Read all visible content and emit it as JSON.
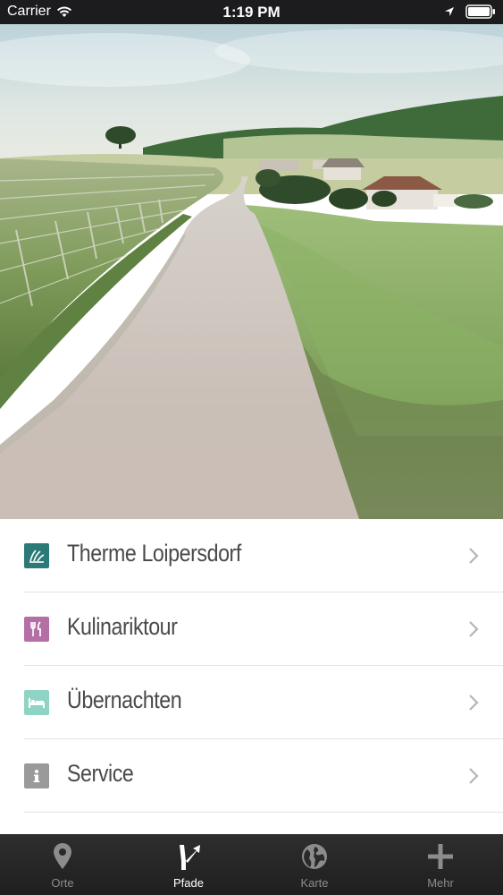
{
  "status_bar": {
    "carrier": "Carrier",
    "time": "1:19 PM"
  },
  "menu": {
    "items": [
      {
        "label": "Therme Loipersdorf",
        "icon": "spa-leaf-icon",
        "icon_color": "#2c7a78"
      },
      {
        "label": "Kulinariktour",
        "icon": "fork-knife-icon",
        "icon_color": "#b46fa6"
      },
      {
        "label": "Übernachten",
        "icon": "bed-icon",
        "icon_color": "#8fd3c4"
      },
      {
        "label": "Service",
        "icon": "info-icon",
        "icon_color": "#9a9a9a"
      }
    ]
  },
  "tab_bar": {
    "tabs": [
      {
        "label": "Orte",
        "icon": "map-pin-icon",
        "active": false
      },
      {
        "label": "Pfade",
        "icon": "path-signpost-icon",
        "active": true
      },
      {
        "label": "Karte",
        "icon": "globe-icon",
        "active": false
      },
      {
        "label": "Mehr",
        "icon": "plus-icon",
        "active": false
      }
    ]
  },
  "colors": {
    "separator": "#e3e3e3",
    "label_text": "#4a4a4a",
    "tab_bar_bg": "#262626",
    "tab_active": "#ffffff",
    "tab_inactive": "#8c8c8c"
  }
}
